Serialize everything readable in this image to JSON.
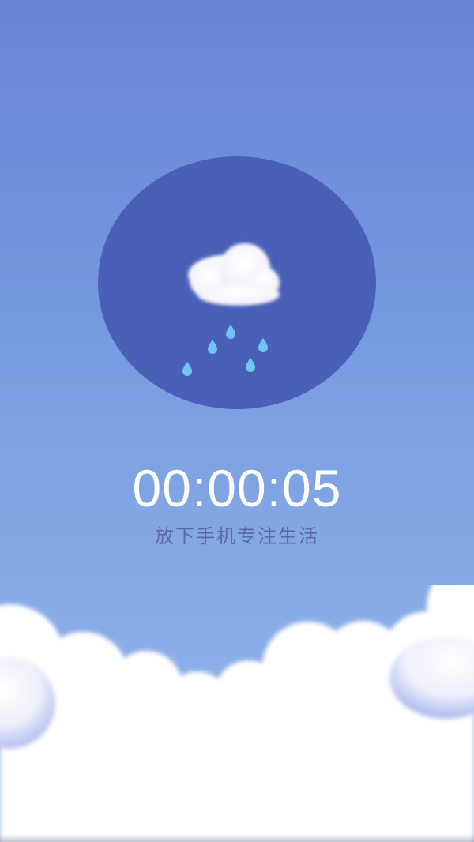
{
  "theme": {
    "sky_top": "#6883d6",
    "sky_bottom": "#94b7ec",
    "orb_color": "#4a60b8",
    "drop_color": "#6fc4f4",
    "timer_color": "#ffffff",
    "slogan_color": "#5d6aa6"
  },
  "weather_illustration": {
    "icon": "rain-cloud-icon"
  },
  "timer": {
    "value": "00:00:05"
  },
  "slogan": {
    "text": "放下手机专注生活"
  }
}
